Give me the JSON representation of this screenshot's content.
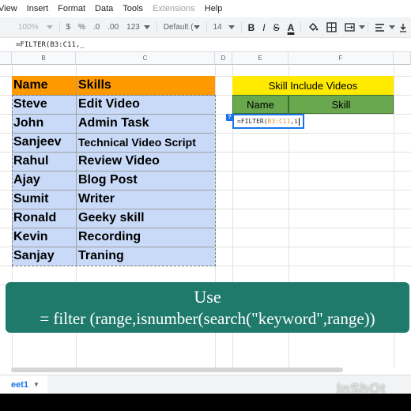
{
  "menu": [
    "View",
    "Insert",
    "Format",
    "Data",
    "Tools",
    "Extensions",
    "Help"
  ],
  "toolbar": {
    "zoom": "100%",
    "currency": "$",
    "percent": "%",
    "dec_decrease": ".0",
    "dec_increase": ".00",
    "more_formats": "123",
    "font": "Default (Ari...",
    "font_size": "14",
    "bold": "B",
    "italic": "I",
    "strike": "S",
    "text_color": "A"
  },
  "formula_bar": "=FILTER(B3:C11,_",
  "columns": [
    "B",
    "C",
    "D",
    "E",
    "F"
  ],
  "table": {
    "headers": [
      "Name",
      "Skills"
    ],
    "rows": [
      [
        "Steve",
        "Edit Video"
      ],
      [
        "John",
        "Admin Task"
      ],
      [
        "Sanjeev",
        "Technical Video Script"
      ],
      [
        "Rahul",
        "Review Video"
      ],
      [
        "Ajay",
        "Blog Post"
      ],
      [
        "Sumit",
        "Writer"
      ],
      [
        "Ronald",
        "Geeky skill"
      ],
      [
        "Kevin",
        "Recording"
      ],
      [
        "Sanjay",
        "Traning"
      ]
    ]
  },
  "result_block": {
    "title": "Skill Include Videos",
    "headers": [
      "Name",
      "Skill"
    ],
    "editing_prefix": "=FILTER(",
    "editing_range": "B3:C11",
    "editing_suffix": ",i",
    "help_icon": "?"
  },
  "banner": {
    "line1": "Use",
    "line2": "= filter (range,isnumber(search(\"keyword\",range))"
  },
  "sheet_tab": "eet1",
  "watermark": "InShOt",
  "colors": {
    "header_orange": "#ff9900",
    "body_blue": "#c9daf8",
    "title_yellow": "#ffea00",
    "header_green": "#6aa84f",
    "banner_teal": "#1f7a6c"
  }
}
